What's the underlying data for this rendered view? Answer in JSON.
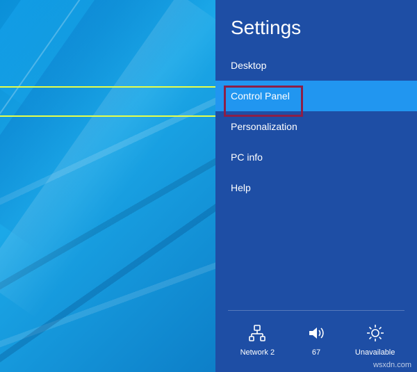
{
  "panel": {
    "title": "Settings",
    "items": [
      {
        "label": "Desktop",
        "highlighted": false
      },
      {
        "label": "Control Panel",
        "highlighted": true
      },
      {
        "label": "Personalization",
        "highlighted": false
      },
      {
        "label": "PC info",
        "highlighted": false
      },
      {
        "label": "Help",
        "highlighted": false
      }
    ]
  },
  "footer": {
    "network": {
      "label": "Network 2",
      "icon": "network-icon"
    },
    "volume": {
      "label": "67",
      "icon": "volume-icon"
    },
    "brightness": {
      "label": "Unavailable",
      "icon": "brightness-icon"
    }
  },
  "watermark": "wsxdn.com",
  "colors": {
    "panel_bg": "#1e4ea5",
    "highlight_bg": "#2196f0",
    "annotation_border": "#8b1f47",
    "highlight_line": "#e6ff4a"
  }
}
